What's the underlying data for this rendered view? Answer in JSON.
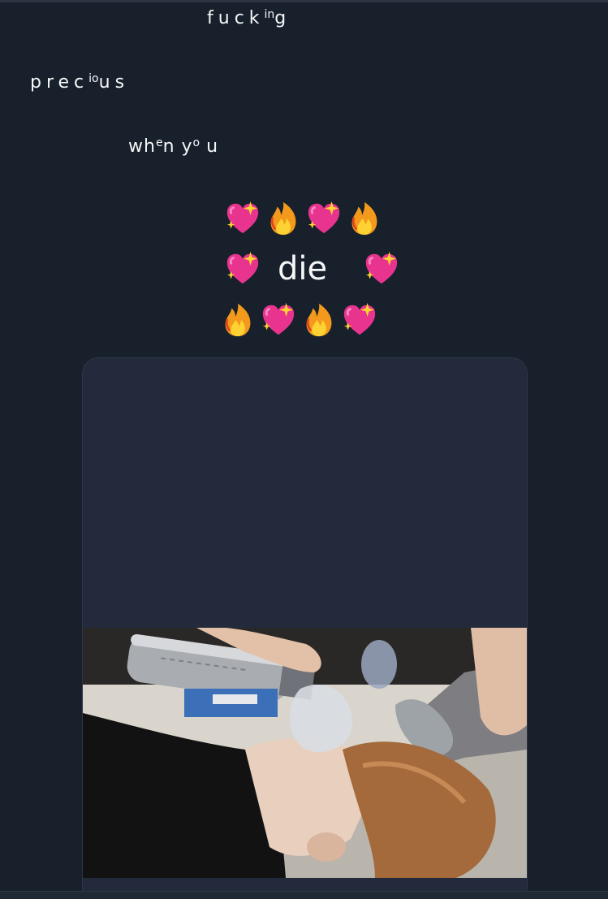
{
  "tweet": {
    "line1": {
      "text": "fuck",
      "sup": "in",
      "tail": "g"
    },
    "line2": {
      "text": "prec",
      "sup": "io",
      "tail": "us"
    },
    "line3": {
      "text": "wh",
      "sup1": "e",
      "mid": "n y",
      "sup2": "o",
      "tail": " u"
    },
    "emoji_row_1": [
      "sparkling-heart-icon",
      "fire-icon",
      "sparkling-heart-icon",
      "fire-icon"
    ],
    "emoji_row_2": {
      "left_icon": "sparkling-heart-icon",
      "word": "die",
      "right_icon": "sparkling-heart-icon"
    },
    "emoji_row_3": [
      "fire-icon",
      "sparkling-heart-icon",
      "fire-icon",
      "sparkling-heart-icon"
    ]
  },
  "media": {
    "image": "photo-person-lying-with-oxygen-mask"
  },
  "colors": {
    "background": "#17202b",
    "card": "#232a3c",
    "text": "#f5f6f8",
    "heart": "#e8348f",
    "fire": "#f39a1d"
  }
}
